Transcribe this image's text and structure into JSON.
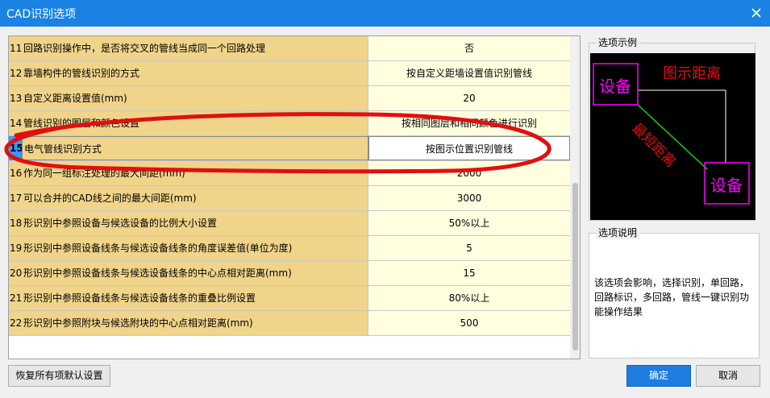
{
  "window": {
    "title": "CAD识别选项"
  },
  "icons": {
    "close": "close-icon"
  },
  "colors": {
    "titlebar": "#1a82e2",
    "label_cell": "#f0d48a",
    "value_cell": "#ffffe0",
    "annotation": "#e01010",
    "selected_num": "#3399ff"
  },
  "grid": {
    "selected_index": "15",
    "rows": [
      {
        "num": "11",
        "label": "回路识别操作中，是否将交叉的管线当成同一个回路处理",
        "value": "否"
      },
      {
        "num": "12",
        "label": "靠墙构件的管线识别的方式",
        "value": "按自定义距墙设置值识别管线"
      },
      {
        "num": "13",
        "label": "自定义距离设置值(mm)",
        "value": "20"
      },
      {
        "num": "14",
        "label": "管线识别的图层和颜色设置",
        "value": "按相同图层和相同颜色进行识别"
      },
      {
        "num": "15",
        "label": "电气管线识别方式",
        "value": "按图示位置识别管线"
      },
      {
        "num": "16",
        "label": "作为同一组标注处理的最大间距(mm)",
        "value": "2000"
      },
      {
        "num": "17",
        "label": "可以合并的CAD线之间的最大间距(mm)",
        "value": "3000"
      },
      {
        "num": "18",
        "label": "形识别中参照设备与候选设备的比例大小设置",
        "value": "50%以上"
      },
      {
        "num": "19",
        "label": "形识别中参照设备线条与候选设备线条的角度误差值(单位为度)",
        "value": "5"
      },
      {
        "num": "20",
        "label": "形识别中参照设备线条与候选设备线条的中心点相对距离(mm)",
        "value": "15"
      },
      {
        "num": "21",
        "label": "形识别中参照设备线条与候选设备线条的重叠比例设置",
        "value": "80%以上"
      },
      {
        "num": "22",
        "label": "形识别中参照附块与候选附块的中心点相对距离(mm)",
        "value": "500"
      }
    ]
  },
  "example": {
    "title": "选项示例",
    "device_a": "设备",
    "device_b": "设备",
    "diagram_distance": "图示距离",
    "shortest_distance": "最短距离"
  },
  "description": {
    "title": "选项说明",
    "text": "该选项会影响，选择识别，单回路，回路标识，多回路，管线一键识别功能操作结果"
  },
  "buttons": {
    "reset": "恢复所有项默认设置",
    "ok": "确定",
    "cancel": "取消"
  }
}
